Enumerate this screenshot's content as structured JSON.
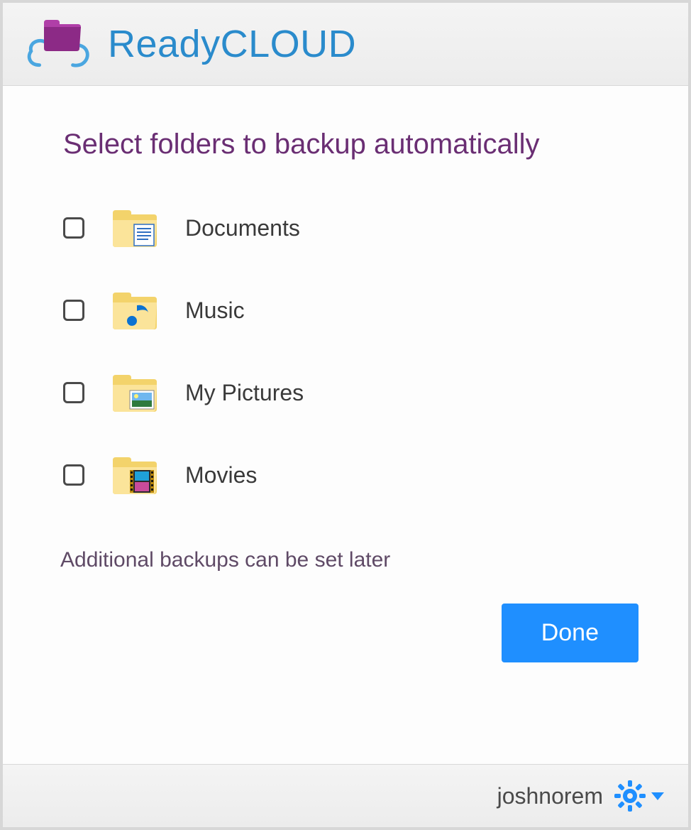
{
  "app": {
    "title": "ReadyCLOUD"
  },
  "main": {
    "heading": "Select folders to backup automatically",
    "note": "Additional backups can be set later",
    "done_label": "Done"
  },
  "folders": [
    {
      "label": "Documents",
      "icon": "documents-folder-icon",
      "checked": false
    },
    {
      "label": "Music",
      "icon": "music-folder-icon",
      "checked": false
    },
    {
      "label": "My Pictures",
      "icon": "pictures-folder-icon",
      "checked": false
    },
    {
      "label": "Movies",
      "icon": "movies-folder-icon",
      "checked": false
    }
  ],
  "footer": {
    "username": "joshnorem"
  },
  "colors": {
    "accent": "#1f8fff",
    "heading": "#6a2e73",
    "title": "#2a8bcc"
  }
}
